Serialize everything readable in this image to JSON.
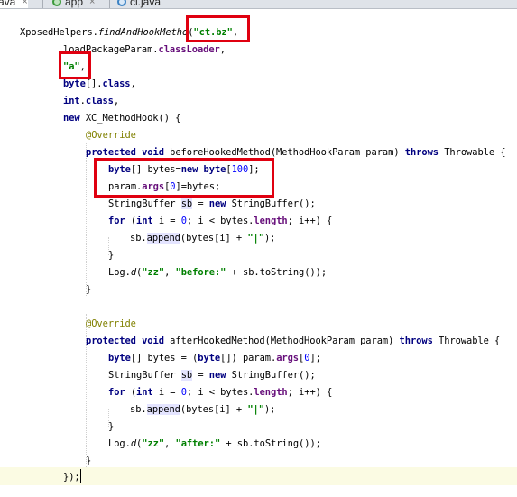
{
  "tabs": [
    {
      "label": "ava",
      "close": "×",
      "icon": "none"
    },
    {
      "label": "app",
      "close": "×",
      "icon": "app-module-icon"
    },
    {
      "label": "ci.java",
      "close": "",
      "icon": "java-class-icon"
    }
  ],
  "code": {
    "l1a": "XposedHelpers.",
    "l1b": "findAndHookMetho",
    "l1c": "(",
    "l1d": "\"ct.bz\"",
    "l1e": ",",
    "l2a": "loadPackageParam.",
    "l2b": "classLoader",
    "l2c": ",",
    "l3a": "\"a\"",
    "l3b": ",",
    "l4a": "byte",
    "l4b": "[].",
    "l4c": "class",
    "l4d": ",",
    "l5a": "int",
    "l5b": ".",
    "l5c": "class",
    "l5d": ",",
    "l6a": "new",
    "l6b": " XC_MethodHook() {",
    "l7": "@Override",
    "l8a": "protected",
    "l8b": "void",
    "l8c": " beforeHookedMethod(MethodHookParam param) ",
    "l8d": "throws",
    "l8e": " Throwable {",
    "l9a": "byte",
    "l9b": "[] bytes=",
    "l9c": "new",
    "l9d": "byte",
    "l9e": "[",
    "l9f": "100",
    "l9g": "];",
    "l10a": "param.",
    "l10b": "args",
    "l10c": "[",
    "l10d": "0",
    "l10e": "]=bytes;",
    "l11a": "StringBuffer ",
    "l11b": "sb",
    "l11c": " = ",
    "l11d": "new",
    "l11e": " StringBuffer();",
    "l12a": "for",
    "l12b": " (",
    "l12c": "int",
    "l12d": " i = ",
    "l12e": "0",
    "l12f": "; i < bytes.",
    "l12g": "length",
    "l12h": "; i++) {",
    "l13a": "sb.",
    "l13b": "append",
    "l13c": "(bytes[i] + ",
    "l13d": "\"|\"",
    "l13e": ");",
    "l14": "}",
    "l15a": "Log.",
    "l15b": "d",
    "l15c": "(",
    "l15d": "\"zz\"",
    "l15e": ", ",
    "l15f": "\"before:\"",
    "l15g": " + sb.toString());",
    "l16": "}",
    "l17": "@Override",
    "l18a": "protected",
    "l18b": "void",
    "l18c": " afterHookedMethod(MethodHookParam param) ",
    "l18d": "throws",
    "l18e": " Throwable {",
    "l19a": "byte",
    "l19b": "[] bytes = (",
    "l19c": "byte",
    "l19d": "[]) param.",
    "l19e": "args",
    "l19f": "[",
    "l19g": "0",
    "l19h": "];",
    "l20a": "StringBuffer ",
    "l20b": "sb",
    "l20c": " = ",
    "l20d": "new",
    "l20e": " StringBuffer();",
    "l21a": "for",
    "l21b": " (",
    "l21c": "int",
    "l21d": " i = ",
    "l21e": "0",
    "l21f": "; i < bytes.",
    "l21g": "length",
    "l21h": "; i++) {",
    "l22a": "sb.",
    "l22b": "append",
    "l22c": "(bytes[i] + ",
    "l22d": "\"|\"",
    "l22e": ");",
    "l23": "}",
    "l24a": "Log.",
    "l24b": "d",
    "l24c": "(",
    "l24d": "\"zz\"",
    "l24e": ", ",
    "l24f": "\"after:\"",
    "l24g": " + sb.toString());",
    "l25": "}",
    "l26": "});"
  },
  "colors": {
    "keyword": "#000080",
    "string": "#008000",
    "field": "#660e7a",
    "number": "#0000ff",
    "annotation": "#808000",
    "highlight_box": "#e00010"
  }
}
